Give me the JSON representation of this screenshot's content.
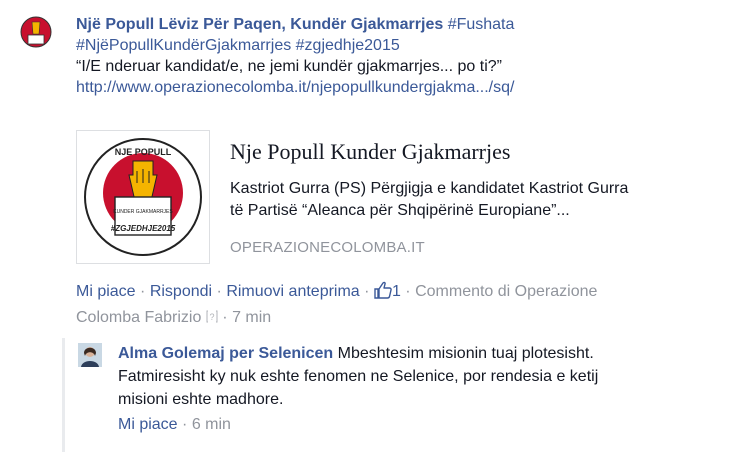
{
  "comment": {
    "author": "Një Popull Lëviz Për Paqen, Kundër Gjakmarrjes",
    "hashtags_line1": "#Fushata",
    "hashtags_line2": "#NjëPopullKundërGjakmarrjes #zgjedhje2015",
    "quote": "“I/E nderuar kandidat/e, ne jemi kundër gjakmarrjes... po ti?”",
    "url": "http://www.operazionecolomba.it/njepopullkundergjakma.../sq/"
  },
  "preview": {
    "logo_text_top": "NJE POPULL",
    "logo_text_mid": "KUNDER GJAKMARRJES",
    "logo_text_bottom": "#ZGJEDHJE2015",
    "title": "Nje Popull Kunder Gjakmarrjes",
    "desc_line1": "Kastriot Gurra (PS) Përgjigja e kandidatet Kastriot Gurra",
    "desc_line2": "të Partisë “Aleanca për Shqipërinë Europiane”...",
    "domain": "OPERAZIONECOLOMBA.IT"
  },
  "actions": {
    "like": "Mi piace",
    "reply": "Rispondi",
    "remove_preview": "Rimuovi anteprima",
    "like_count": "1",
    "comment_by": "Commento di Operazione",
    "comment_by_line2": "Colomba Fabrizio",
    "time": "7 min",
    "separator": "·"
  },
  "reply": {
    "author": "Alma Golemaj per Selenicen",
    "text_line1": "Mbeshtesim misionin tuaj plotesisht.",
    "text_line2": "Fatmiresisht ky nuk eshte fenomen ne Selenice, por rendesia e ketij",
    "text_line3": "misioni eshte madhore.",
    "like": "Mi piace",
    "time": "6 min"
  },
  "colors": {
    "link": "#3b5998",
    "muted": "#90949c",
    "logo_red": "#c8102e",
    "logo_yellow": "#f5b400"
  }
}
